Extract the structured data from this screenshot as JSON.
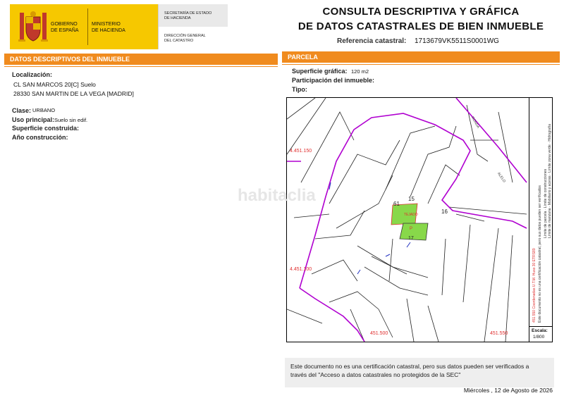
{
  "header": {
    "gov_line1": "GOBIERNO",
    "gov_line2": "DE ESPAÑA",
    "min_line1": "MINISTERIO",
    "min_line2": "DE HACIENDA",
    "sec_line1": "SECRETARÍA DE ESTADO",
    "sec_line2": "DE HACIENDA",
    "dir_line1": "DIRECCIÓN GENERAL",
    "dir_line2": "DEL CATASTRO",
    "title_line1": "CONSULTA DESCRIPTIVA Y GRÁFICA",
    "title_line2": "DE DATOS CATASTRALES DE BIEN INMUEBLE",
    "ref_label": "Referencia catastral:",
    "ref_value": "1713679VK5511S0001WG"
  },
  "left": {
    "section_title": "DATOS DESCRIPTIVOS DEL INMUEBLE",
    "localizacion_label": "Localización:",
    "address_line1": "CL SAN MARCOS 20[C] Suelo",
    "address_line2": "28330 SAN MARTIN DE LA VEGA [MADRID]",
    "clase_label": "Clase:",
    "clase_value": "URBANO",
    "uso_label": "Uso principal:",
    "uso_value": "Suelo sin edif.",
    "superficie_label": "Superficie construida:",
    "anio_label": "Año construcción:"
  },
  "right": {
    "section_title": "PARCELA",
    "superficie_label": "Superficie gráfica:",
    "superficie_value": "120 m2",
    "participacion_label": "Participación del inmueble:",
    "tipo_label": "Tipo:"
  },
  "map": {
    "coord_y1": "4.451.150",
    "coord_y2": "4.451.100",
    "coord_x1": "451.500",
    "coord_x2": "451.550",
    "watermark": "habitaclia",
    "label_15": "15",
    "label_16": "16",
    "label_17": "17",
    "label_61": "61",
    "label_p": "P",
    "label_tejado": "TEJADO",
    "street_top": "RONDA",
    "street_right": "ALELO",
    "legend_1": "Límite de manzana",
    "legend_2": "Límite de parcela",
    "legend_3": "Límite de construcciones",
    "legend_4": "Mobiliario y aceras",
    "legend_5": "Límite zona verde",
    "legend_6": "Hidrografía",
    "legend_coords": "451.550 Coordenadas U.T.M. Huso 30 ETRS89",
    "legend_note": "Este documento no es una certificación catastral, pero sus datos pueden ser verificados",
    "escala_label": "Escala:",
    "escala_value": "1/800"
  },
  "footer": {
    "note_line1": "Este documento no es una certificación catastral, pero sus datos pueden ser verificados a",
    "note_line2": "través del \"Acceso a datos catastrales no protegidos de la SEC\"",
    "date": "Miércoles , 12 de Agosto de 2026"
  },
  "colors": {
    "accent": "#f08b1e",
    "yellow": "#f6c800",
    "boundary": "#b000d0",
    "parcel": "#88d84a",
    "coord_red": "#e03030",
    "number_blue": "#2030c0"
  }
}
